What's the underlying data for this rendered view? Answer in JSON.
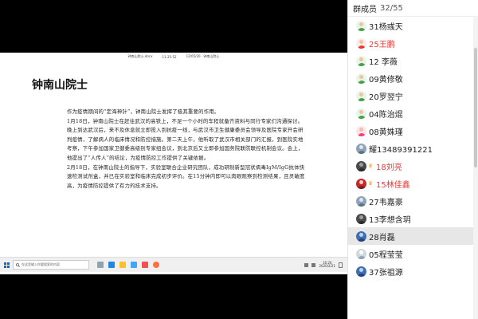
{
  "document": {
    "heading": "钟南山院士",
    "paragraphs": [
      "作为疫情期间的“定海神针”，钟南山院士发挥了极其重要的作用。",
      "1月18日，钟南山院士在赶往武汉的高铁上，不足一个小时的车程就备齐资料与同行专家们沟通探讨。晚上到达武汉后，来不及休息就立即投入到抗疫一线，与武汉市卫生健康委员会领导及医院专家开会研判疫情，了解病人的临床情况和防控措施。第二天上午，他听取了武汉市相关部门的汇报，到医院实地考察，下午参加国家卫健委高级别专家组会议，到北京后又立即参加国务院联防联控机制会议。会上，他提出了“人传人”的结论，为疫情防控工作提供了关键依据。",
      "2月18日，在钟南山院士的指导下，实验室联合企业研究团队，成功研制新型冠状病毒IgM/IgG抗体快速检测试剂盒，并已在实验室和临床完成初步评价。在15分钟内即可以肉眼观察到检测结果，且灵敏度高，为疫情防控提供了有力的技术支持。"
    ]
  },
  "window_title": {
    "left": "钟南山院士.docx",
    "mid": "11-25-52",
    "right": "12/05/20 · 钟南山院士"
  },
  "taskbar": {
    "search_placeholder": "在这里输入你要搜索的内容",
    "time": "16:26",
    "date": "2020/2/21"
  },
  "panel": {
    "title": "群成员",
    "count": "32/55"
  },
  "members": [
    {
      "name": "31杨彧天",
      "name_color": "#222222",
      "avatar": "male-green",
      "badge": "none",
      "selected": false
    },
    {
      "name": "25王鹏",
      "name_color": "#e53935",
      "avatar": "male-red",
      "badge": "none",
      "selected": false
    },
    {
      "name": "12 李薇",
      "name_color": "#222222",
      "avatar": "male-green",
      "badge": "none",
      "selected": false
    },
    {
      "name": "09黄修敬",
      "name_color": "#222222",
      "avatar": "male-green",
      "badge": "none",
      "selected": false
    },
    {
      "name": "20罗翌宁",
      "name_color": "#222222",
      "avatar": "male-green",
      "badge": "none",
      "selected": false
    },
    {
      "name": "04陈治焜",
      "name_color": "#222222",
      "avatar": "male-green",
      "badge": "none",
      "selected": false
    },
    {
      "name": "08黄姝瑾",
      "name_color": "#222222",
      "avatar": "female-pink",
      "badge": "none",
      "selected": false
    },
    {
      "name": "耀13489391221",
      "name_color": "#222222",
      "avatar": "photo",
      "badge": "none",
      "selected": false
    },
    {
      "name": "18刘亮",
      "name_color": "#e53935",
      "avatar": "photo-dark",
      "badge": "crown",
      "selected": false
    },
    {
      "name": "15林佳鑫",
      "name_color": "#e53935",
      "avatar": "photo-red",
      "badge": "crown",
      "selected": false
    },
    {
      "name": "27韦嘉豪",
      "name_color": "#222222",
      "avatar": "photo",
      "badge": "none",
      "selected": false
    },
    {
      "name": "13李想含玥",
      "name_color": "#222222",
      "avatar": "photo-dark",
      "badge": "none",
      "selected": false
    },
    {
      "name": "28肖磊",
      "name_color": "#222222",
      "avatar": "photo-blue",
      "badge": "none",
      "selected": true
    },
    {
      "name": "05程莹莹",
      "name_color": "#222222",
      "avatar": "photo-light",
      "badge": "none",
      "selected": false
    },
    {
      "name": "37张祖源",
      "name_color": "#222222",
      "avatar": "photo-blue",
      "badge": "none",
      "selected": false
    }
  ],
  "colors": {
    "accent_red": "#e53935",
    "selected_row": "#e7e7e7",
    "crown": "#f5a623"
  }
}
